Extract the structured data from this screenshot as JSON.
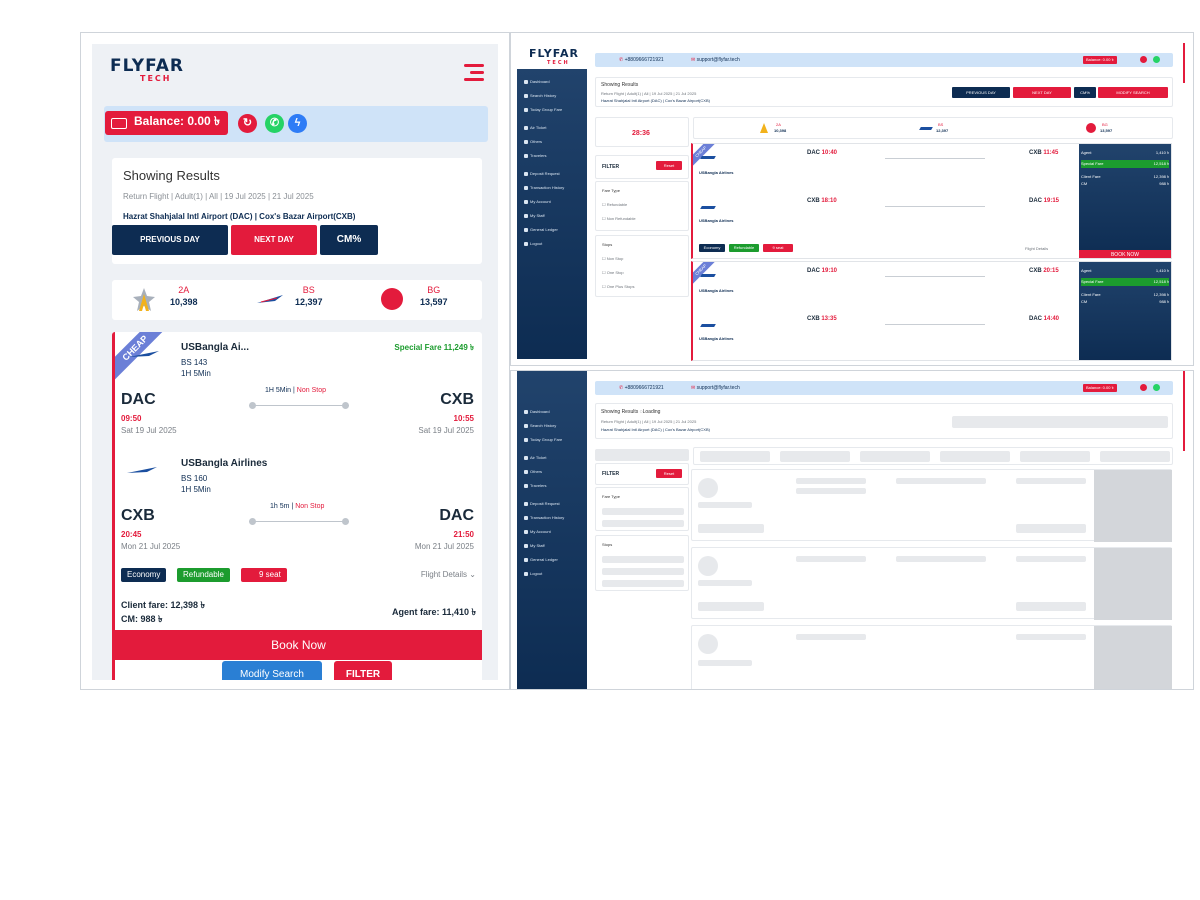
{
  "mobile": {
    "logo": {
      "main": "FLYFAR",
      "sub": "TECH"
    },
    "balance_label": "Balance: 0.00 ৳",
    "results": {
      "title": "Showing Results",
      "summary": "Return Flight | Adult(1) | All | 19 Jul 2025 | 21 Jul 2025",
      "route": "Hazrat Shahjalal Intl Airport (DAC) | Cox's Bazar Airport(CXB)",
      "prev_day": "PREVIOUS DAY",
      "next_day": "NEXT DAY",
      "cm": "CM%"
    },
    "airlines": [
      {
        "code": "2A",
        "price": "10,398"
      },
      {
        "code": "BS",
        "price": "12,397"
      },
      {
        "code": "BG",
        "price": "13,597"
      }
    ],
    "flight": {
      "ribbon": "CHEAP",
      "special_fare": "Special Fare 11,249 ৳",
      "outbound": {
        "airline": "USBangla Ai...",
        "flight_no": "BS 143",
        "duration": "1H 5Min",
        "from_code": "DAC",
        "from_time": "09:50",
        "from_date": "Sat 19 Jul 2025",
        "to_code": "CXB",
        "to_time": "10:55",
        "to_date": "Sat 19 Jul 2025",
        "route_duration": "1H 5Min",
        "stops": "Non Stop"
      },
      "inbound": {
        "airline": "USBangla Airlines",
        "flight_no": "BS 160",
        "duration": "1H 5Min",
        "from_code": "CXB",
        "from_time": "20:45",
        "from_date": "Mon 21 Jul 2025",
        "to_code": "DAC",
        "to_time": "21:50",
        "to_date": "Mon 21 Jul 2025",
        "route_duration": "1h 5m",
        "stops": "Non Stop"
      },
      "tags": {
        "cabin": "Economy",
        "refund": "Refundable",
        "seats": "9 seat"
      },
      "flight_details": "Flight Details",
      "client_fare": "Client fare: 12,398 ৳",
      "cm": "CM: 988 ৳",
      "agent_fare": "Agent fare: 11,410 ৳",
      "book_now": "Book Now"
    },
    "modify_search": "Modify Search",
    "filter": "FILTER"
  },
  "desktop": {
    "phone": "+8809666721921",
    "email": "support@flyfar.tech",
    "balance": "Balance: 0.00 ৳",
    "sidebar": [
      "Dashboard",
      "Search History",
      "Today Group Fare",
      "Air Ticket",
      "Others",
      "Travelers",
      "Deposit Request",
      "Transaction History",
      "My Account",
      "My Staff",
      "General Ledger",
      "Logout"
    ],
    "results_title": "Showing Results",
    "results_title_loading": "Showing Results",
    "loading_label": "Loading",
    "summary": "Return Flight | Adult(1) | All | 19 Jul 2025 | 21 Jul 2025",
    "route": "Hazrat Shahjalal Intl Airport (DAC) | Cox's Bazar Airport(CXB)",
    "prev_day": "PREVIOUS DAY",
    "next_day": "NEXT DAY",
    "cm": "CM%",
    "modify": "MODIFY SEARCH",
    "timer": "28:36",
    "filter": "FILTER",
    "reset": "Reset",
    "fare_type": "Fare Type",
    "refundable": "Refundable",
    "non_refundable": "Non Refundable",
    "stops": "Stops",
    "non_stop": "Non Stop",
    "one_stop": "One Stop",
    "one_plus_stops": "One Plus Stops",
    "airline_prices": [
      "10,398",
      "12,397",
      "13,597"
    ],
    "airline_codes": [
      "2A",
      "BS",
      "BG"
    ],
    "flights": [
      {
        "ribbon": "CHEAP",
        "out": {
          "airline": "USBangla Airlines",
          "from": "DAC",
          "from_time": "10:40",
          "to": "CXB",
          "to_time": "11:45"
        },
        "in": {
          "airline": "USBangla Airlines",
          "from": "CXB",
          "from_time": "18:10",
          "to": "DAC",
          "to_time": "19:15"
        },
        "cabin": "Economy",
        "refund": "Refundable",
        "seats": "9 seat",
        "agent": "Agent",
        "agent_fare": "1,410 ৳",
        "special": "Special Fare",
        "special_fare": "12,518 ৳",
        "client": "Client Fare",
        "client_fare": "12,398 ৳",
        "cm": "CM",
        "cm_fare": "988 ৳",
        "book": "BOOK NOW",
        "details": "Flight Details"
      },
      {
        "ribbon": "CHEAP",
        "out": {
          "airline": "USBangla Airlines",
          "from": "DAC",
          "from_time": "19:10",
          "to": "CXB",
          "to_time": "20:15"
        },
        "in": {
          "airline": "USBangla Airlines",
          "from": "CXB",
          "from_time": "13:35",
          "to": "DAC",
          "to_time": "14:40"
        },
        "agent": "Agent",
        "agent_fare": "1,410 ৳",
        "special": "Special Fare",
        "special_fare": "12,518 ৳",
        "client": "Client Fare",
        "client_fare": "12,398 ৳",
        "cm": "CM",
        "cm_fare": "988 ৳"
      }
    ]
  },
  "colors": {
    "navy": "#0d2c52",
    "red": "#e31b3c",
    "green": "#1c9c2e",
    "light_blue": "#cfe3f8",
    "blue_button": "#2a7fd4"
  }
}
